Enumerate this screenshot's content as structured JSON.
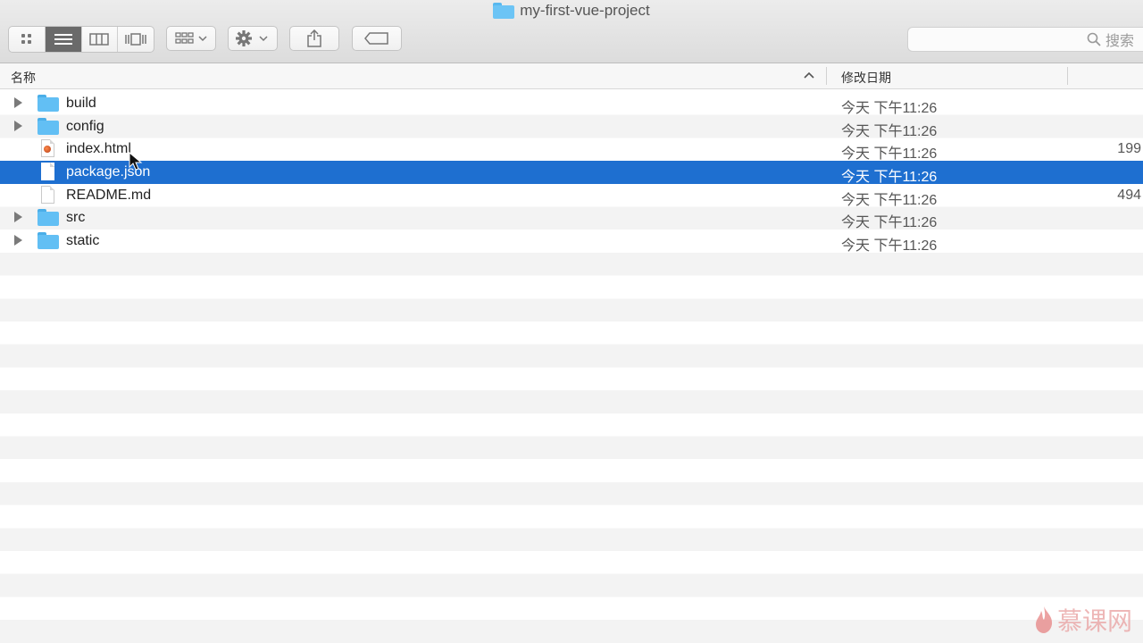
{
  "window": {
    "title": "my-first-vue-project"
  },
  "toolbar": {
    "view_buttons": [
      "icon-view",
      "list-view",
      "column-view",
      "cover-flow-view"
    ],
    "arrange_icon": "arrange-icon",
    "action_icon": "gear-icon",
    "share_icon": "share-icon",
    "tag_icon": "tag-icon"
  },
  "search": {
    "placeholder": "搜索"
  },
  "columns": {
    "name": "名称",
    "date": "修改日期"
  },
  "files": [
    {
      "name": "build",
      "type": "folder",
      "date": "今天 下午11:26",
      "size": ""
    },
    {
      "name": "config",
      "type": "folder",
      "date": "今天 下午11:26",
      "size": ""
    },
    {
      "name": "index.html",
      "type": "html",
      "date": "今天 下午11:26",
      "size": "199"
    },
    {
      "name": "package.json",
      "type": "file",
      "date": "今天 下午11:26",
      "size": "",
      "selected": true
    },
    {
      "name": "README.md",
      "type": "file",
      "date": "今天 下午11:26",
      "size": "494"
    },
    {
      "name": "src",
      "type": "folder",
      "date": "今天 下午11:26",
      "size": ""
    },
    {
      "name": "static",
      "type": "folder",
      "date": "今天 下午11:26",
      "size": ""
    }
  ],
  "watermark": {
    "text": "慕课网"
  },
  "colors": {
    "selection": "#1e6fd0",
    "folder": "#62bff4"
  }
}
